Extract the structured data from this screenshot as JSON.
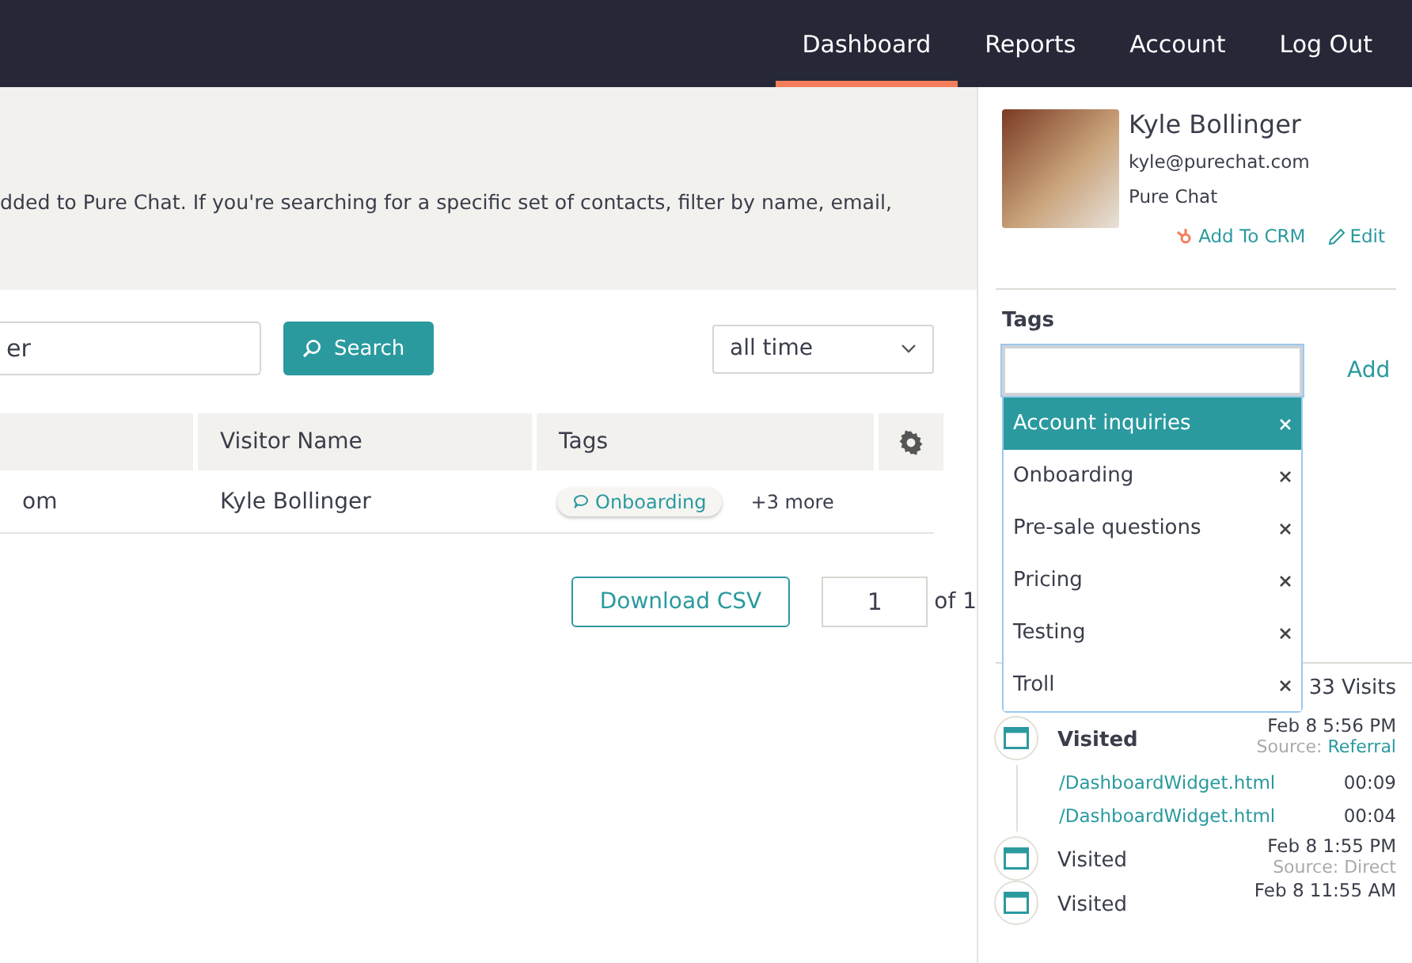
{
  "nav": {
    "items": [
      {
        "label": "Dashboard",
        "selected": true
      },
      {
        "label": "Reports",
        "selected": false
      },
      {
        "label": "Account",
        "selected": false
      },
      {
        "label": "Log Out",
        "selected": false
      }
    ]
  },
  "intro": {
    "text": "dded to Pure Chat. If you're searching for a specific set of contacts, filter by name, email,"
  },
  "filters": {
    "search_value": "er",
    "search_button": "Search",
    "range": "all time"
  },
  "table": {
    "columns": [
      "",
      "Visitor Name",
      "Tags"
    ],
    "rows": [
      {
        "cells": [
          "om",
          "Kyle Bollinger"
        ],
        "tag": "Onboarding",
        "more": "+3 more"
      }
    ]
  },
  "footer": {
    "download": "Download CSV",
    "page": "1",
    "of": "of 1"
  },
  "contact": {
    "name": "Kyle Bollinger",
    "email": "kyle@purechat.com",
    "company": "Pure Chat",
    "add_crm": "Add To CRM",
    "edit": "Edit"
  },
  "tags": {
    "label": "Tags",
    "add": "Add",
    "options": [
      {
        "label": "Account inquiries",
        "selected": true
      },
      {
        "label": "Onboarding",
        "selected": false
      },
      {
        "label": "Pre-sale questions",
        "selected": false
      },
      {
        "label": "Pricing",
        "selected": false
      },
      {
        "label": "Testing",
        "selected": false
      },
      {
        "label": "Troll",
        "selected": false
      }
    ]
  },
  "visits": {
    "count": "33 Visits",
    "entries": [
      {
        "label": "Visited",
        "bold": true,
        "time": "Feb 8 5:56 PM",
        "source_label": "Source:",
        "source": "Referral",
        "source_link": true,
        "pages": [
          {
            "path": "/DashboardWidget.html",
            "duration": "00:09"
          },
          {
            "path": "/DashboardWidget.html",
            "duration": "00:04"
          }
        ]
      },
      {
        "label": "Visited",
        "bold": false,
        "time": "Feb 8 1:55 PM",
        "source_label": "Source:",
        "source": "Direct",
        "source_link": false
      },
      {
        "label": "Visited",
        "bold": false,
        "time": "Feb 8 11:55 AM"
      }
    ]
  }
}
